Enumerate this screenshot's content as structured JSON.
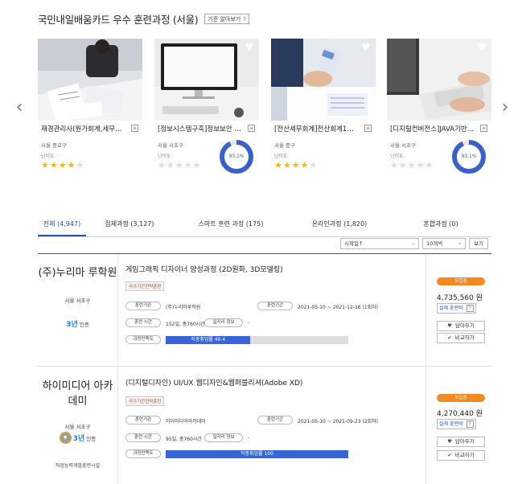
{
  "section": {
    "title": "국민내일배움카드 우수 훈련과정 (서울)",
    "standard_btn": "기준 알아보기",
    "standard_icon": "?"
  },
  "nav": {
    "prev_icon": "‹",
    "next_icon": "›"
  },
  "cards": [
    {
      "title": "재경관리사(원가회계,세무회…",
      "region": "서울 중로구",
      "difficulty": "난이도",
      "stars": 4,
      "rate": null
    },
    {
      "title": "[정보시스템구축]정보보안 취…",
      "region": "서울 서초구",
      "difficulty": "난이도",
      "stars": 0,
      "rate": "93.1%"
    },
    {
      "title": "[전산세무회계]전산회계1급 …",
      "region": "서울 중구",
      "difficulty": "난이도",
      "stars": 4,
      "rate": null
    },
    {
      "title": "[디지털컨버전스]JAVA기반 …",
      "region": "서울 서초구",
      "difficulty": "난이도",
      "stars": 0,
      "rate": "93.1%"
    }
  ],
  "tabs": [
    {
      "label": "전체 (4,947)",
      "active": true
    },
    {
      "label": "집체과정 (3,127)",
      "active": false
    },
    {
      "label": "스마트 훈련 과정 (175)",
      "active": false
    },
    {
      "label": "온라인과정 (1,820)",
      "active": false
    },
    {
      "label": "혼합과정 (0)",
      "active": false
    }
  ],
  "sort": {
    "order": "시작일↑",
    "per_page": "10개씩",
    "view_btn": "보기"
  },
  "items": [
    {
      "org_name": "(주)누리마 루학원",
      "org_region": "서울 서초구",
      "cert_years": "3년",
      "cert_suffix": "인증",
      "org_footer": "",
      "title": "게임그래픽 디자이너 양성과정 (2D원화, 3D모델링)",
      "tag": "국가기간전략훈련",
      "lbl_org": "훈련기관",
      "val_org": "(주)누리마루학원",
      "lbl_period": "훈련기간",
      "val_period": "2021-05-10 ~ 2021-12-16 (1회차)",
      "lbl_time": "훈련 시간",
      "val_time": "152일, 총760시간",
      "lbl_cert": "일자리 정보",
      "val_cert": "-",
      "lbl_sat": "과정만족도",
      "progress_label": "직종취업률 46.4",
      "progress_pct": 46.4,
      "badge": "모집중",
      "price": "4,735,560 원",
      "subsidy": "실제 훈련비",
      "subsidy_q": "?",
      "like": "담아두기",
      "compare": "비교하기"
    },
    {
      "org_name": "하이미디어 아카데미",
      "org_region": "서울 서초구",
      "cert_years": "3년",
      "cert_suffix": "인증",
      "org_footer": "직업능력개발훈련시설",
      "title": "(디지털디자인) UI/UX 웹디자인&웹퍼블리셔(Adobe XD)",
      "tag": "국가기간전략훈련",
      "lbl_org": "훈련기관",
      "val_org": "하이미디어아카데미",
      "lbl_period": "훈련기간",
      "val_period": "2021-05-10 ~ 2021-09-23 (2회차)",
      "lbl_time": "훈련 시간",
      "val_time": "95일, 총760시간",
      "lbl_cert": "일자리 정보",
      "val_cert": "-",
      "lbl_sat": "과정만족도",
      "progress_label": "직종취업률 100",
      "progress_pct": 100,
      "badge": "모집중",
      "price": "4,270,440 원",
      "subsidy": "실제 훈련비",
      "subsidy_q": "?",
      "like": "담아두기",
      "compare": "비교하기"
    }
  ],
  "colors": {
    "accent": "#1f52b8",
    "progress": "#3566d4",
    "badge": "#f08a24",
    "star": "#f0b429"
  }
}
